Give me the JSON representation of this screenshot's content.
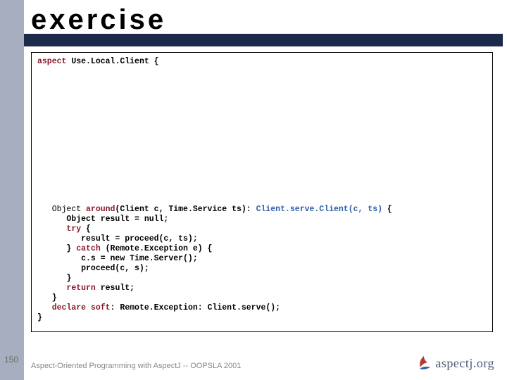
{
  "title": "exercise",
  "code": {
    "l1": {
      "kw": "aspect",
      "rest": " Use.Local.Client {"
    },
    "blank_lines": 14,
    "l2": {
      "indent": "   Object ",
      "kw": "around",
      "sig": "(Client c, Time.Service ts): ",
      "pc": "Client.serve.Client(c, ts)",
      "tail": " {"
    },
    "l3": "      Object result = null;",
    "l4": {
      "indent": "      ",
      "kw": "try",
      "tail": " {"
    },
    "l5": "         result = proceed(c, ts);",
    "l6": {
      "indent": "      } ",
      "kw": "catch",
      "tail": " (Remote.Exception e) {"
    },
    "l7": "         c.s = new Time.Server();",
    "l8": "         proceed(c, s);",
    "l9": "      }",
    "l10": {
      "indent": "      ",
      "kw": "return",
      "tail": " result;"
    },
    "l11": "   }",
    "l12": {
      "indent": "   ",
      "kw": "declare soft",
      "tail": ": Remote.Exception: Client.serve();"
    },
    "l13": "}"
  },
  "footer": {
    "slide_number": "150",
    "text": "Aspect-Oriented Programming with AspectJ -- OOPSLA 2001",
    "logo_text": "aspectj.org"
  }
}
